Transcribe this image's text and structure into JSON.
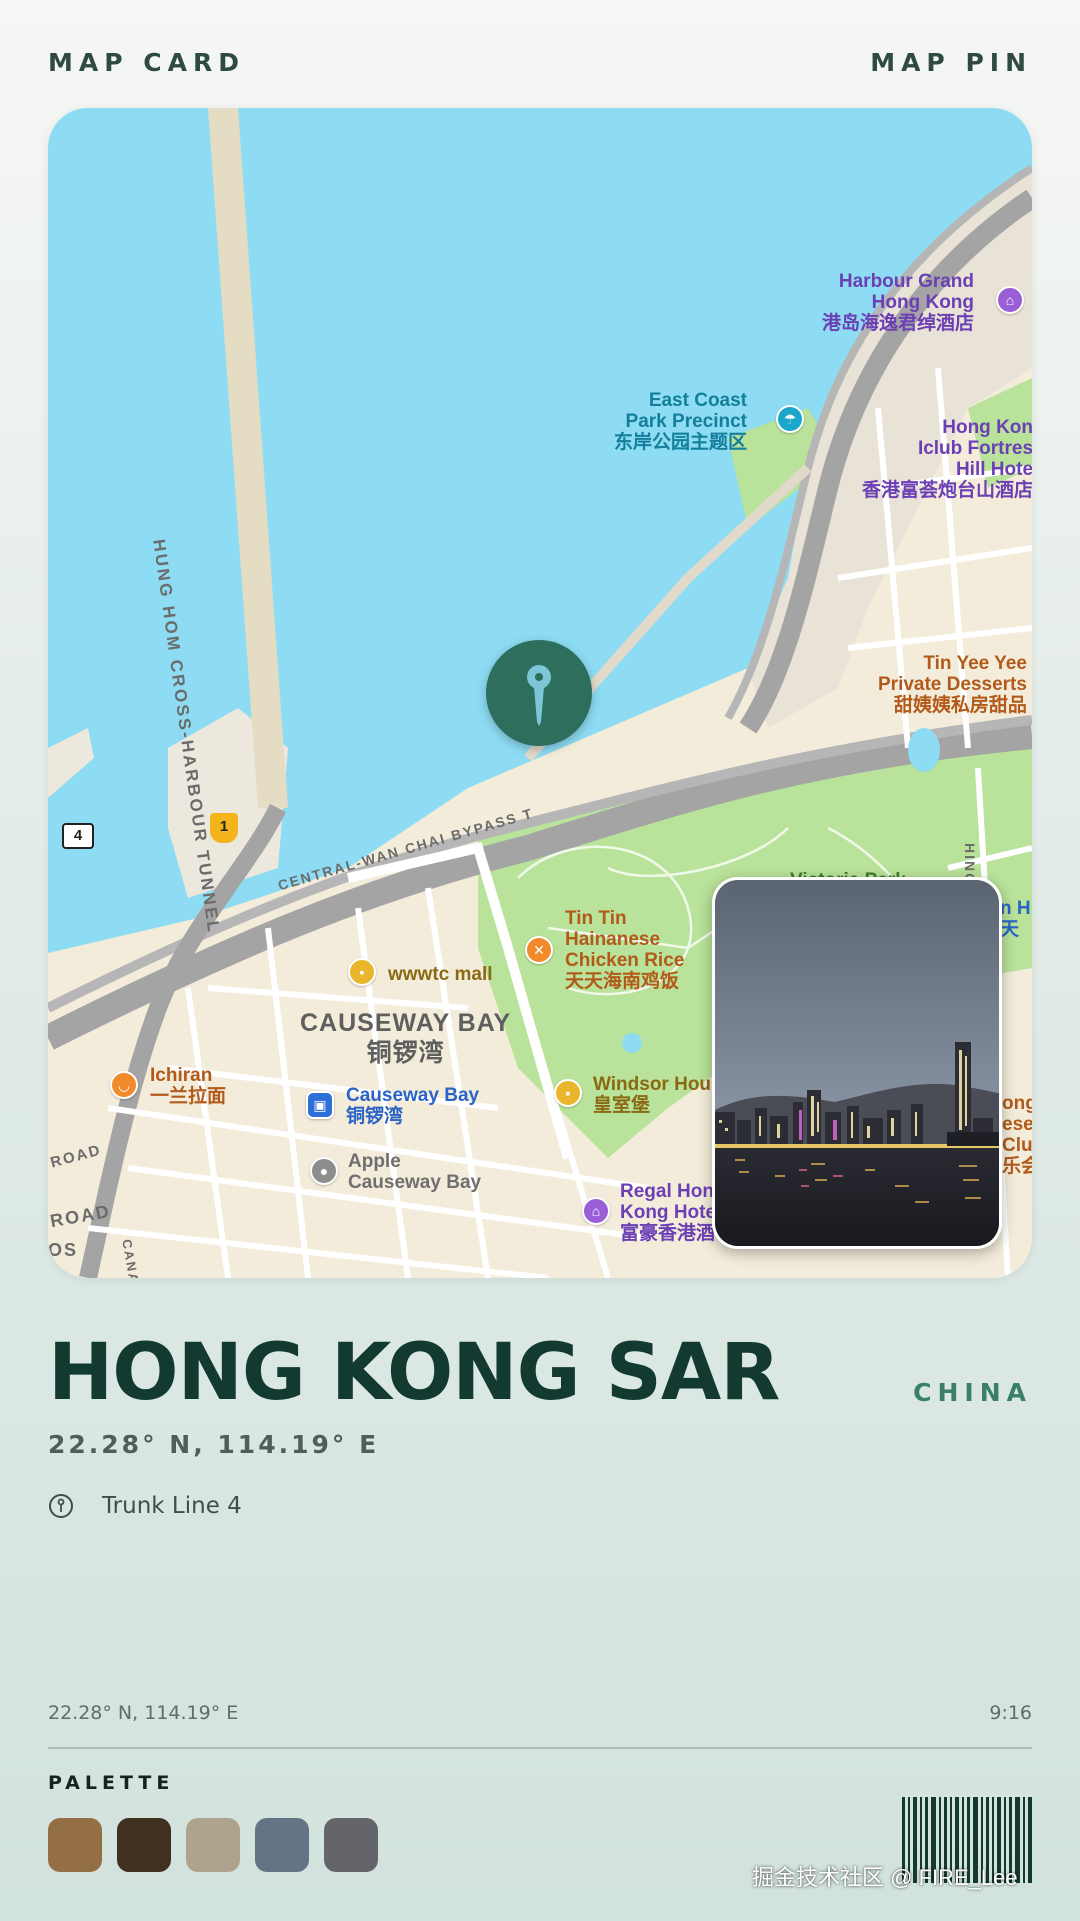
{
  "header": {
    "left_label": "MAP CARD",
    "right_label": "MAP PIN"
  },
  "map": {
    "pin_icon": "map-pin-icon",
    "labels": {
      "harbour_grand": "Harbour Grand\nHong Kong\n港岛海逸君绰酒店",
      "east_coast": "East Coast\nPark Precinct\n东岸公园主题区",
      "iclub": "Hong Kon\nIclub Fortres\nHill Hote\n香港富荟炮台山酒店",
      "tin_yee": "Tin Yee Yee\nPrivate Desserts\n甜姨姨私房甜品",
      "victoria_park": "Victoria Park",
      "tin_tin": "Tin Tin\nHainanese\nChicken Rice\n天天海南鸡饭",
      "wwwtc": "wwwtc mall",
      "district": "CAUSEWAY BAY\n铜锣湾",
      "ichiran": "Ichiran\n一兰拉面",
      "causeway_station": "Causeway Bay\n铜锣湾",
      "windsor": "Windsor Hou\n皇室堡",
      "apple": "Apple\nCauseway Bay",
      "regal": "Regal Hon\nKong Hote\n富豪香港酒",
      "tin_hau": "n H\n天",
      "right_edge": "ong\nese\nClub\n乐会",
      "road_left_a": "ROAD",
      "road_left_b": "ROAD",
      "road_left_c": "OS",
      "road_left_d": "CANA"
    },
    "road_names": {
      "tunnel": "HUNG HOM CROSS-HARBOUR TUNNEL",
      "bypass": "CENTRAL-WAN CHAI BYPASS T",
      "street": "HING FAT STREET"
    },
    "route_shields": {
      "left": "4",
      "right": "1"
    }
  },
  "location": {
    "city": "HONG KONG SAR",
    "country": "CHINA",
    "coords": "22.28° N, 114.19° E",
    "trunk_icon": "trunk-line-icon",
    "trunk_line": "Trunk Line 4"
  },
  "footer": {
    "coords": "22.28° N, 114.19° E",
    "time": "9:16",
    "palette_title": "PALETTE",
    "swatches": [
      "#946f46",
      "#3f3020",
      "#aea48e",
      "#657484",
      "#64656a"
    ],
    "watermark": "掘金技术社区 @ FIRE_Lee"
  },
  "colors": {
    "accent": "#2d6e5d",
    "title": "#123a30",
    "water": "#8ddcf3",
    "park": "#b9e29a"
  }
}
